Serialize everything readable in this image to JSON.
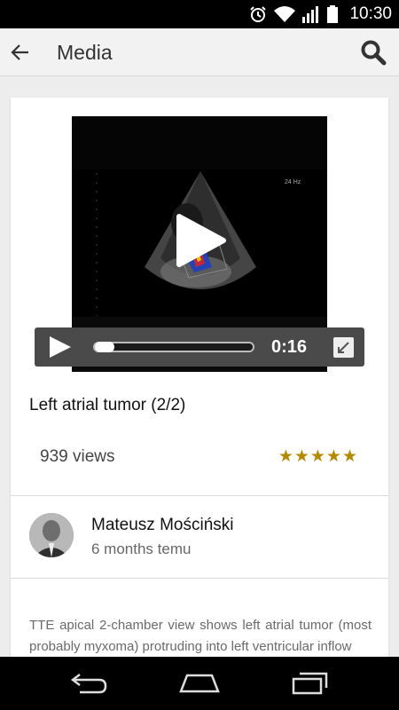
{
  "status_bar": {
    "time": "10:30",
    "icons": [
      "alarm-icon",
      "wifi-icon",
      "signal-icon",
      "battery-icon"
    ]
  },
  "app_bar": {
    "title": "Media",
    "back_icon": "arrow-left-icon",
    "search_icon": "search-icon"
  },
  "video": {
    "overlay_ultrasound_label": "24 Hz",
    "current_time": "0:16",
    "progress_fraction": 0.0,
    "controls": [
      "play-icon",
      "fullscreen-icon"
    ]
  },
  "media": {
    "title": "Left atrial tumor (2/2)",
    "views": "939 views",
    "rating_display": "★★★★★",
    "rating_value": 5,
    "rating_color": "#b38a00"
  },
  "author": {
    "name": "Mateusz Mościński",
    "time_ago": "6 months temu"
  },
  "description": "TTE apical 2-chamber view shows left atrial tumor (most probably myxoma) protruding into left ventricular inflow",
  "nav_bar": {
    "buttons": [
      "back-nav-icon",
      "home-nav-icon",
      "recents-nav-icon"
    ]
  }
}
